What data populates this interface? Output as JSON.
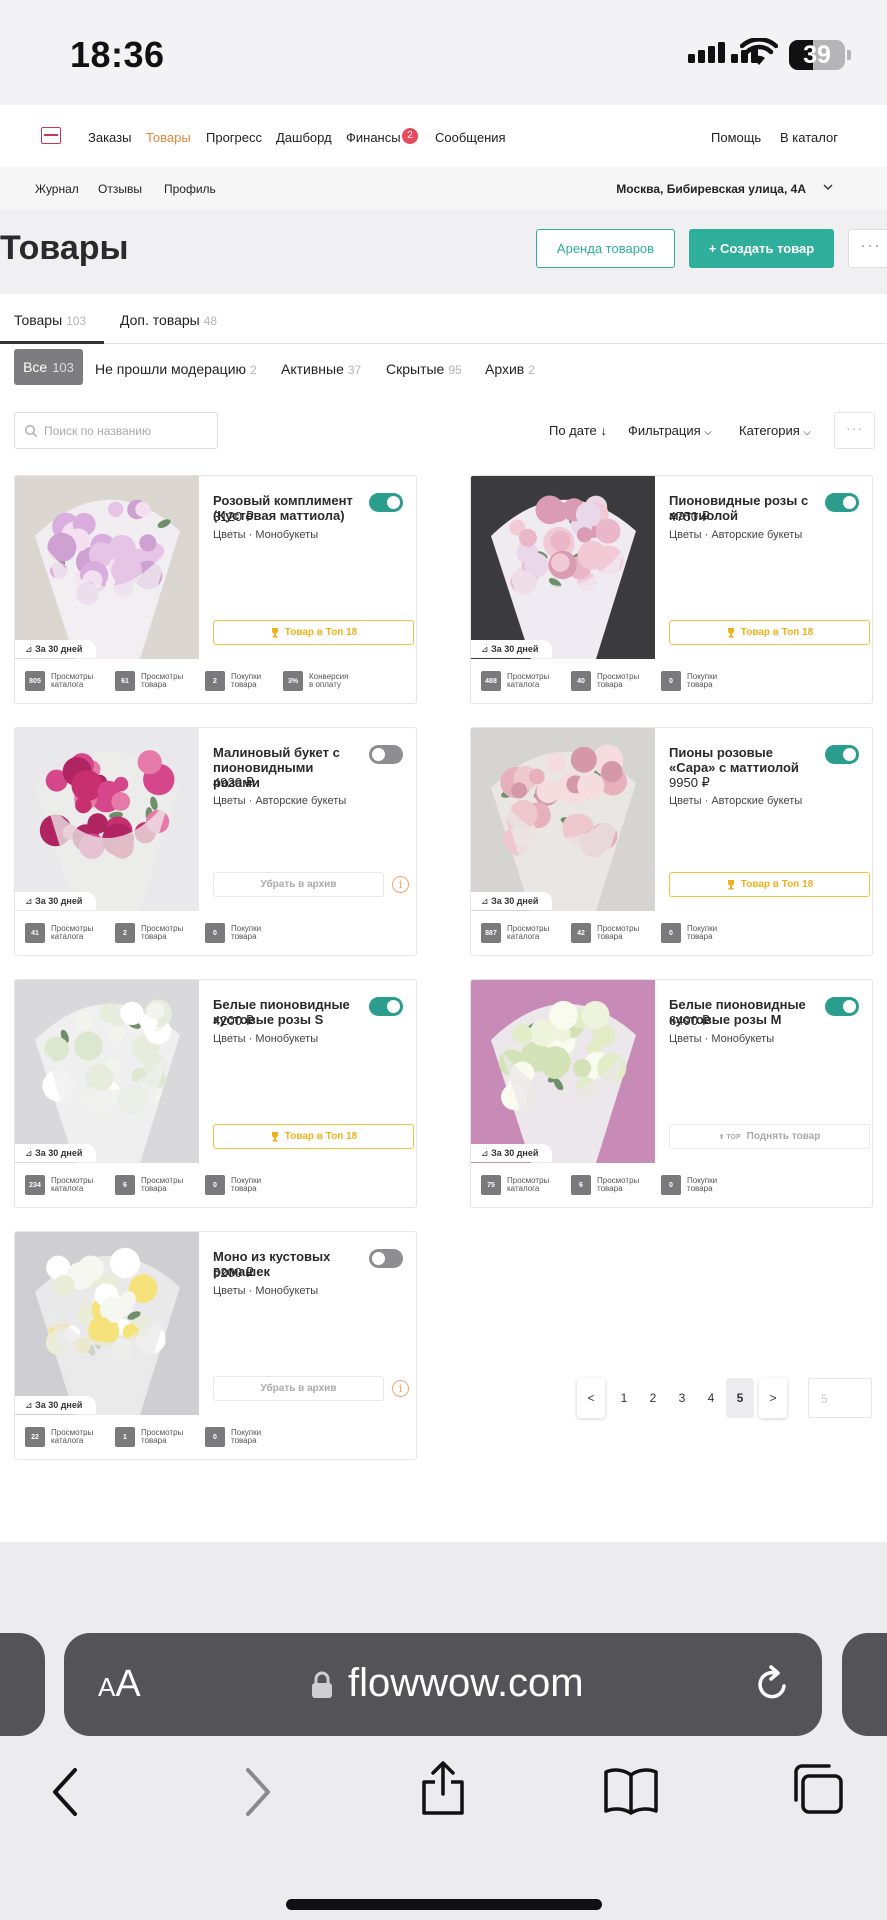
{
  "status": {
    "time": "18:36",
    "battery": "39"
  },
  "nav": {
    "items": [
      {
        "label": "Заказы"
      },
      {
        "label": "Товары"
      },
      {
        "label": "Прогресс"
      },
      {
        "label": "Дашборд"
      },
      {
        "label": "Финансы"
      },
      {
        "label": "Сообщения"
      }
    ],
    "finance_badge": "2",
    "help": "Помощь",
    "to_catalog": "В каталог"
  },
  "subnav": {
    "items": [
      {
        "label": "Журнал"
      },
      {
        "label": "Отзывы"
      },
      {
        "label": "Профиль"
      }
    ],
    "address": "Москва, Бибиревская улица, 4А"
  },
  "header": {
    "title": "Товары",
    "rent_button": "Аренда товаров",
    "create_button": "+ Создать товар",
    "more": "···"
  },
  "tabs": [
    {
      "label": "Товары",
      "count": "103"
    },
    {
      "label": "Доп. товары",
      "count": "48"
    }
  ],
  "chips": [
    {
      "label": "Все",
      "count": "103"
    },
    {
      "label": "Не прошли модерацию",
      "count": "2"
    },
    {
      "label": "Активные",
      "count": "37"
    },
    {
      "label": "Скрытые",
      "count": "95"
    },
    {
      "label": "Архив",
      "count": "2"
    }
  ],
  "list_controls": {
    "search_placeholder": "Поиск по названию",
    "sort": "По дате",
    "filter": "Фильтрация",
    "category": "Категория",
    "more": "···"
  },
  "card_common": {
    "period": "За 30 дней",
    "top_button": "Товар в Топ 18",
    "archive_button": "Убрать в архив",
    "raise_button": "Поднять товар",
    "raise_tag": "TOP",
    "stat_catalog": "Просмотры каталога",
    "stat_product": "Просмотры товара",
    "stat_purchases": "Покупки товара",
    "stat_conversion": "Конверсия в оплату"
  },
  "products": [
    {
      "name": "Розовый комплимент (Кустовая маттиола)",
      "price": "3120 ₽",
      "category": "Цветы · Монобукеты",
      "active": true,
      "action": "top",
      "stats": {
        "catalog_views": "805",
        "product_views": "61",
        "purchases": "2",
        "conversion": "3%"
      }
    },
    {
      "name": "Пионовидные розы с маттиолой",
      "price": "4750 ₽",
      "category": "Цветы · Авторские букеты",
      "active": true,
      "action": "top",
      "stats": {
        "catalog_views": "488",
        "product_views": "40",
        "purchases": "0"
      }
    },
    {
      "name": "Малиновый букет с пионовидными розами",
      "price": "4920 ₽",
      "category": "Цветы · Авторские букеты",
      "active": false,
      "action": "archive",
      "stats": {
        "catalog_views": "41",
        "product_views": "2",
        "purchases": "0"
      }
    },
    {
      "name": "Пионы розовые «Сара» с маттиолой",
      "price": "9950 ₽",
      "category": "Цветы · Авторские букеты",
      "active": true,
      "action": "top",
      "stats": {
        "catalog_views": "887",
        "product_views": "42",
        "purchases": "0"
      }
    },
    {
      "name": "Белые пионовидные кустовые розы S",
      "price": "4200 ₽",
      "category": "Цветы · Монобукеты",
      "active": true,
      "action": "top",
      "stats": {
        "catalog_views": "234",
        "product_views": "6",
        "purchases": "0"
      }
    },
    {
      "name": "Белые пионовидные кустовые розы M",
      "price": "6490 ₽",
      "category": "Цветы · Монобукеты",
      "active": true,
      "action": "raise",
      "stats": {
        "catalog_views": "75",
        "product_views": "6",
        "purchases": "0"
      }
    },
    {
      "name": "Моно из кустовых ромашек",
      "price": "5200 ₽",
      "category": "Цветы · Монобукеты",
      "active": false,
      "action": "archive",
      "stats": {
        "catalog_views": "22",
        "product_views": "1",
        "purchases": "0"
      }
    }
  ],
  "pagination": {
    "prev": "<",
    "next": ">",
    "pages": [
      "1",
      "2",
      "3",
      "4",
      "5"
    ],
    "current": "5",
    "goto_placeholder": "5"
  },
  "browser": {
    "url": "flowwow.com",
    "aa_small": "A",
    "aa_large": "A"
  },
  "colors": {
    "accent": "#2fae9b",
    "nav_active": "#e4873c",
    "top_button": "#f4c23a",
    "badge": "#e8495c"
  }
}
